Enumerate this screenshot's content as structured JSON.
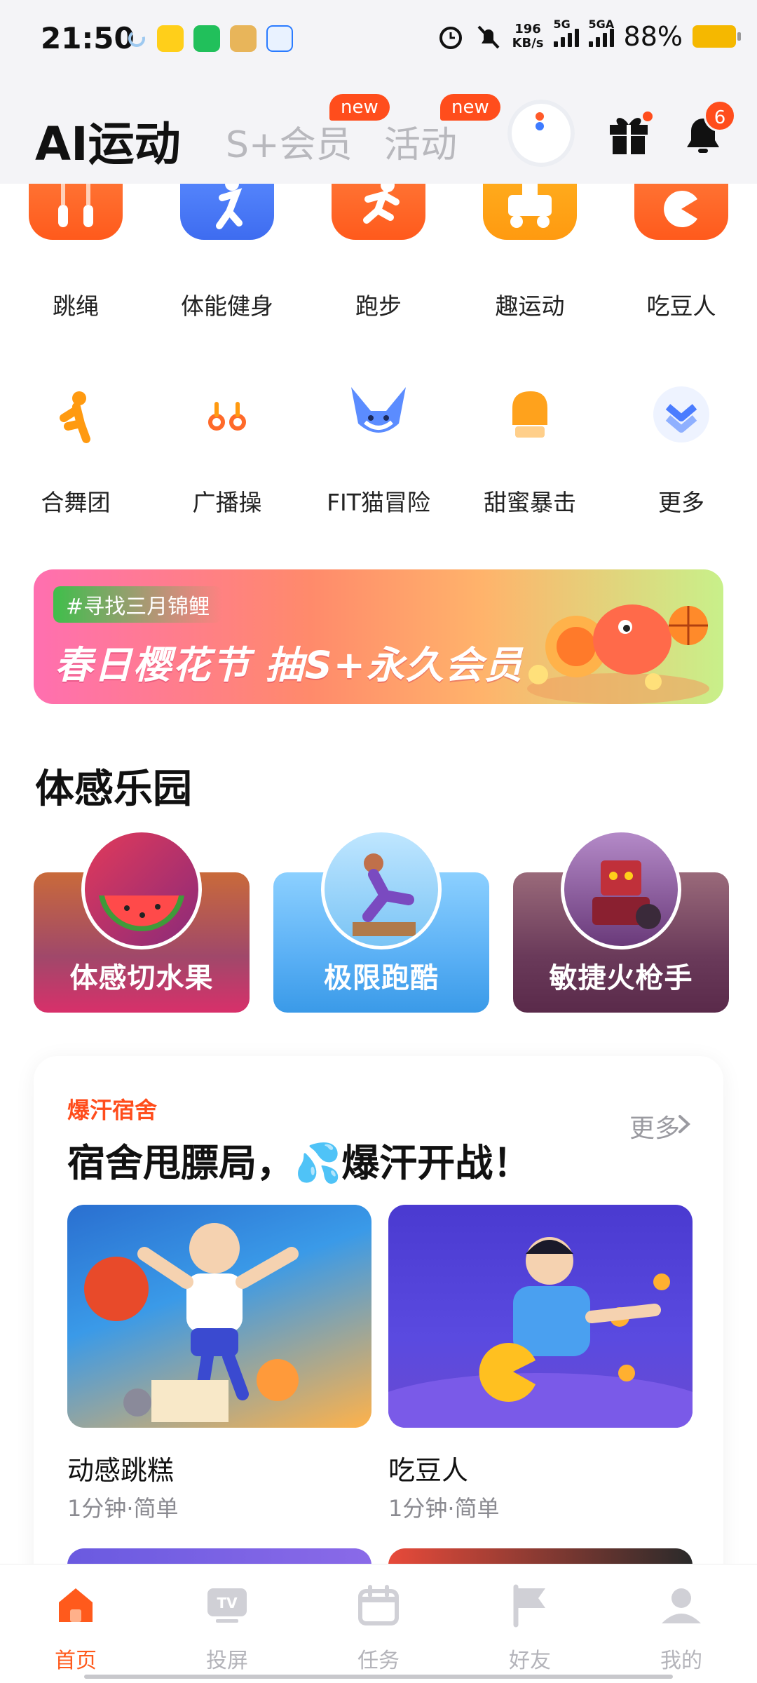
{
  "status_bar": {
    "time": "21:50",
    "net_speed_value": "196",
    "net_speed_unit": "KB/s",
    "sig1_label": "5G",
    "sig2_label": "5GA",
    "battery": "88%"
  },
  "header": {
    "tabs": [
      {
        "label": "AI运动"
      },
      {
        "label": "S+会员",
        "badge": "new"
      },
      {
        "label": "活动",
        "badge": "new"
      }
    ],
    "notification_count": "6"
  },
  "sports_row1": [
    {
      "label": "跳绳",
      "icon": "jump-rope-icon",
      "color": "#ff6a2a"
    },
    {
      "label": "体能健身",
      "icon": "fitness-icon",
      "color": "#4a7cff"
    },
    {
      "label": "跑步",
      "icon": "running-icon",
      "color": "#ff6a2a"
    },
    {
      "label": "趣运动",
      "icon": "fun-sport-icon",
      "color": "#ffa21c"
    },
    {
      "label": "吃豆人",
      "icon": "pacman-icon",
      "color": "#ff6a2a"
    }
  ],
  "sports_row2": [
    {
      "label": "合舞团",
      "icon": "dance-icon"
    },
    {
      "label": "广播操",
      "icon": "exercise-icon"
    },
    {
      "label": "FIT猫冒险",
      "icon": "fox-icon"
    },
    {
      "label": "甜蜜暴击",
      "icon": "boxing-glove-icon"
    },
    {
      "label": "更多",
      "icon": "chevron-double-down-icon"
    }
  ],
  "banner": {
    "tag": "#寻找三月锦鲤",
    "title": "春日樱花节  抽S+永久会员"
  },
  "somatosensory": {
    "title": "体感乐园",
    "games": [
      {
        "title": "体感切水果",
        "icon": "watermelon-icon"
      },
      {
        "title": "极限跑酷",
        "icon": "parkour-icon"
      },
      {
        "title": "敏捷火枪手",
        "icon": "robot-icon"
      }
    ]
  },
  "dorm": {
    "kicker": "爆汗宿舍",
    "title": "宿舍甩膘局，💦爆汗开战！",
    "more": "更多",
    "items": [
      {
        "title": "动感跳糕",
        "meta": "1分钟·简单"
      },
      {
        "title": "吃豆人",
        "meta": "1分钟·简单"
      }
    ]
  },
  "bottom_nav": [
    {
      "label": "首页",
      "icon": "home-icon",
      "active": true
    },
    {
      "label": "投屏",
      "icon": "tv-icon"
    },
    {
      "label": "任务",
      "icon": "calendar-icon"
    },
    {
      "label": "好友",
      "icon": "flag-icon"
    },
    {
      "label": "我的",
      "icon": "profile-icon"
    }
  ],
  "colors": {
    "accent": "#ff5a1c",
    "header_bg": "#f4f4f7",
    "inactive_text": "#b4b4ba"
  }
}
